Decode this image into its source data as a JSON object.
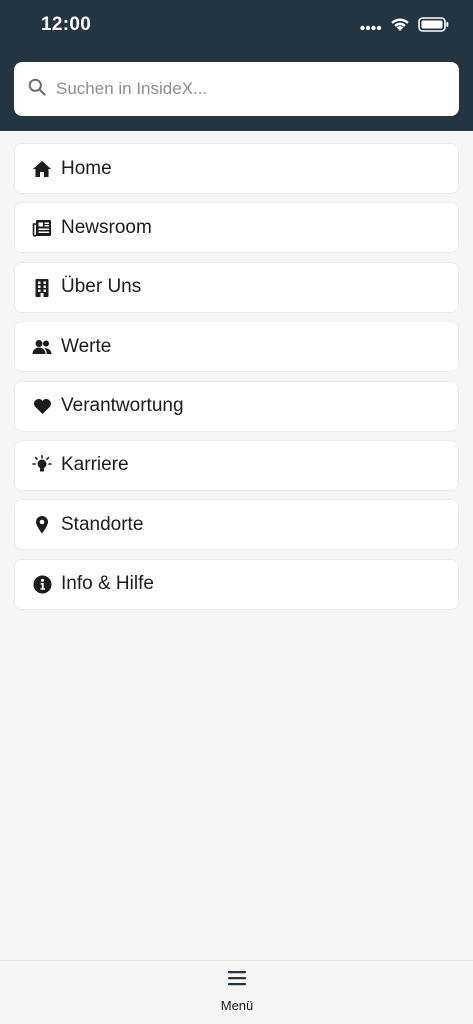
{
  "status_bar": {
    "time": "12:00",
    "icons": [
      "cellular-icon",
      "wifi-icon",
      "battery-icon"
    ]
  },
  "search": {
    "placeholder": "Suchen in InsideX...",
    "icon": "search-icon"
  },
  "menu": {
    "items": [
      {
        "label": "Home",
        "icon": "home-icon"
      },
      {
        "label": "Newsroom",
        "icon": "newspaper-icon"
      },
      {
        "label": "Über Uns",
        "icon": "building-icon"
      },
      {
        "label": "Werte",
        "icon": "users-icon"
      },
      {
        "label": "Verantwortung",
        "icon": "heart-icon"
      },
      {
        "label": "Karriere",
        "icon": "lightbulb-icon"
      },
      {
        "label": "Standorte",
        "icon": "map-pin-icon"
      },
      {
        "label": "Info & Hilfe",
        "icon": "info-circle-icon"
      }
    ]
  },
  "tabbar": {
    "menu_label": "Menü",
    "menu_icon": "hamburger-icon"
  },
  "colors": {
    "header_bg": "#243441",
    "page_bg": "#f6f6f6",
    "card_bg": "#ffffff",
    "text": "#1c1c1e",
    "placeholder": "#8e8e93"
  }
}
